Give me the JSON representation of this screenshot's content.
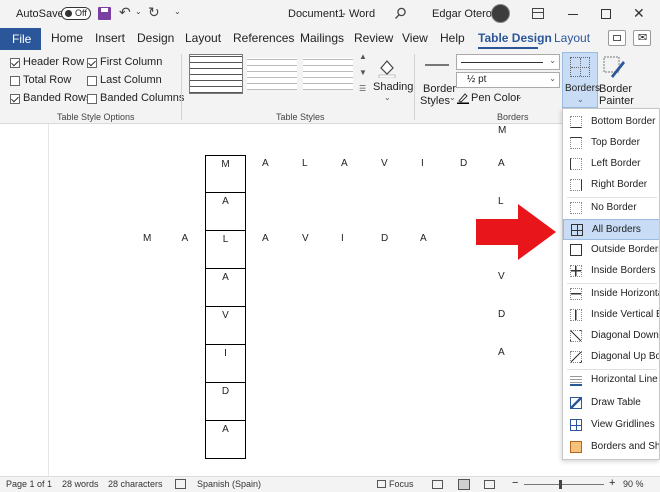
{
  "titlebar": {
    "autosave_label": "AutoSave",
    "autosave_state": "Off",
    "document_name": "Document1",
    "separator": "-",
    "app_name": "Word",
    "user_name": "Edgar Otero"
  },
  "tabs": {
    "file": "File",
    "items": [
      "Home",
      "Insert",
      "Design",
      "Layout",
      "References",
      "Mailings",
      "Review",
      "View",
      "Help",
      "Table Design",
      "Layout"
    ],
    "active": "Table Design"
  },
  "ribbon": {
    "options": {
      "header_row": "Header Row",
      "first_column": "First Column",
      "total_row": "Total Row",
      "last_column": "Last Column",
      "banded_rows": "Banded Rows",
      "banded_columns": "Banded Columns",
      "group_label": "Table Style Options"
    },
    "styles": {
      "group_label": "Table Styles",
      "shading": "Shading"
    },
    "borders": {
      "border_styles_line1": "Border",
      "border_styles_line2": "Styles",
      "weight": "½ pt",
      "pen_color": "Pen Color",
      "borders_button": "Borders",
      "painter_line1": "Border",
      "painter_line2": "Painter",
      "group_label": "Borders"
    }
  },
  "document": {
    "vertical_letters": [
      "M",
      "A",
      "L",
      "A",
      "V",
      "I",
      "D",
      "A"
    ],
    "top_row_letters": [
      "A",
      "L",
      "A",
      "V",
      "I",
      "D",
      "A"
    ],
    "middle_row_prefix": "M A",
    "middle_row_letters": [
      "A",
      "V",
      "I",
      "D",
      "A"
    ],
    "right_column_letters": [
      "M",
      "L",
      "V",
      "D",
      "A"
    ]
  },
  "borders_menu": {
    "items": [
      "Bottom Border",
      "Top Border",
      "Left Border",
      "Right Border",
      "No Border",
      "All Borders",
      "Outside Borders",
      "Inside Borders",
      "Inside Horizontal Border",
      "Inside Vertical Border",
      "Diagonal Down Border",
      "Diagonal Up Border",
      "Horizontal Line",
      "Draw Table",
      "View Gridlines",
      "Borders and Shading..."
    ],
    "highlighted": "All Borders"
  },
  "statusbar": {
    "page": "Page 1 of 1",
    "words": "28 words",
    "characters": "28 characters",
    "language": "Spanish (Spain)",
    "focus": "Focus",
    "zoom": "90 %"
  },
  "colors": {
    "accent": "#2b579a",
    "arrow": "#e8151b",
    "highlight": "#c9dcf5"
  }
}
